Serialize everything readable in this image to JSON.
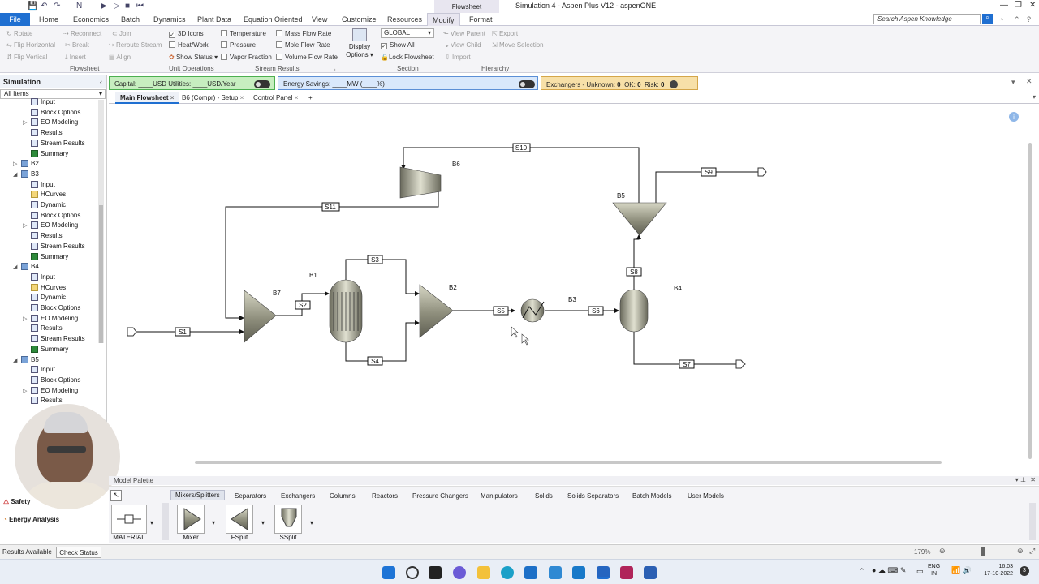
{
  "window": {
    "title": "Simulation 4 - Aspen Plus V12 - aspenONE",
    "context_tab": "Flowsheet"
  },
  "menu": {
    "items": [
      "File",
      "Home",
      "Economics",
      "Batch",
      "Dynamics",
      "Plant Data",
      "Equation Oriented",
      "View",
      "Customize",
      "Resources",
      "Modify",
      "Format"
    ],
    "search_placeholder": "Search Aspen Knowledge"
  },
  "ribbon": {
    "flowsheet_group": {
      "rotate": "Rotate",
      "flip_h": "Flip Horizontal",
      "flip_v": "Flip Vertical",
      "reconnect": "Reconnect",
      "join": "Join",
      "break": "Break",
      "reroute": "Reroute Stream",
      "insert": "Insert",
      "align": "Align",
      "label": "Flowsheet"
    },
    "unit_ops_group": {
      "icons_3d": "3D Icons",
      "heat_work": "Heat/Work",
      "show_status": "Show Status",
      "label": "Unit Operations"
    },
    "stream_results_group": {
      "temperature": "Temperature",
      "pressure": "Pressure",
      "vapor_fraction": "Vapor Fraction",
      "mass_flow": "Mass Flow Rate",
      "mole_flow": "Mole Flow Rate",
      "volume_flow": "Volume Flow Rate",
      "label": "Stream Results"
    },
    "display_options": "Display Options",
    "section_group": {
      "selected": "GLOBAL",
      "show_all": "Show All",
      "lock_flowsheet": "Lock Flowsheet",
      "label": "Section"
    },
    "hierarchy_group": {
      "view_parent": "View Parent",
      "view_child": "View Child",
      "export": "Export",
      "move_selection": "Move Selection",
      "import": "Import",
      "label": "Hierarchy"
    }
  },
  "sidebar": {
    "header": "Simulation",
    "filter": "All Items",
    "tree": [
      {
        "label": "Input",
        "icon": "input"
      },
      {
        "label": "Block Options",
        "icon": "input"
      },
      {
        "label": "EO Modeling",
        "icon": "input"
      },
      {
        "label": "Results",
        "icon": "input"
      },
      {
        "label": "Stream Results",
        "icon": "input"
      },
      {
        "label": "Summary",
        "icon": "ok"
      },
      {
        "label": "B2",
        "icon": "block"
      },
      {
        "label": "B3",
        "icon": "block"
      },
      {
        "label": "Input",
        "icon": "input"
      },
      {
        "label": "HCurves",
        "icon": "folder"
      },
      {
        "label": "Dynamic",
        "icon": "input"
      },
      {
        "label": "Block Options",
        "icon": "input"
      },
      {
        "label": "EO Modeling",
        "icon": "input"
      },
      {
        "label": "Results",
        "icon": "input"
      },
      {
        "label": "Stream Results",
        "icon": "input"
      },
      {
        "label": "Summary",
        "icon": "ok"
      },
      {
        "label": "B4",
        "icon": "block"
      },
      {
        "label": "Input",
        "icon": "input"
      },
      {
        "label": "HCurves",
        "icon": "folder"
      },
      {
        "label": "Dynamic",
        "icon": "input"
      },
      {
        "label": "Block Options",
        "icon": "input"
      },
      {
        "label": "EO Modeling",
        "icon": "input"
      },
      {
        "label": "Results",
        "icon": "input"
      },
      {
        "label": "Stream Results",
        "icon": "input"
      },
      {
        "label": "Summary",
        "icon": "ok"
      },
      {
        "label": "B5",
        "icon": "block"
      },
      {
        "label": "Input",
        "icon": "input"
      },
      {
        "label": "Block Options",
        "icon": "input"
      },
      {
        "label": "EO Modeling",
        "icon": "input"
      },
      {
        "label": "Results",
        "icon": "input"
      }
    ],
    "bottom": {
      "safety": "Safety",
      "energy": "Energy Analysis"
    }
  },
  "status_bars": {
    "capital": "Capital: ____USD  Utilities: ____USD/Year",
    "energy": "Energy Savings: ____MW   (____%)",
    "exchangers": "Exchangers -  Unknown:",
    "unknown": "0",
    "ok_label": "OK:",
    "ok": "0",
    "risk_label": "Risk:",
    "risk": "0"
  },
  "tabs": [
    "Main Flowsheet",
    "B6 (Compr) - Setup",
    "Control Panel"
  ],
  "flowsheet": {
    "blocks": [
      "B1",
      "B2",
      "B3",
      "B4",
      "B5",
      "B6",
      "B7"
    ],
    "streams": [
      "S1",
      "S2",
      "S3",
      "S4",
      "S5",
      "S6",
      "S7",
      "S8",
      "S9",
      "S10",
      "S11"
    ]
  },
  "palette": {
    "header": "Model Palette",
    "tabs": [
      "Mixers/Splitters",
      "Separators",
      "Exchangers",
      "Columns",
      "Reactors",
      "Pressure Changers",
      "Manipulators",
      "Solids",
      "Solids Separators",
      "Batch Models",
      "User Models"
    ],
    "items": [
      "MATERIAL",
      "Mixer",
      "FSplit",
      "SSplit"
    ]
  },
  "statusbar": {
    "left": "Results Available",
    "check": "Check Status",
    "zoom": "179%"
  },
  "taskbar": {
    "lang1": "ENG",
    "lang2": "IN",
    "time": "16:03",
    "date": "17-10-2022",
    "notif": "3"
  }
}
